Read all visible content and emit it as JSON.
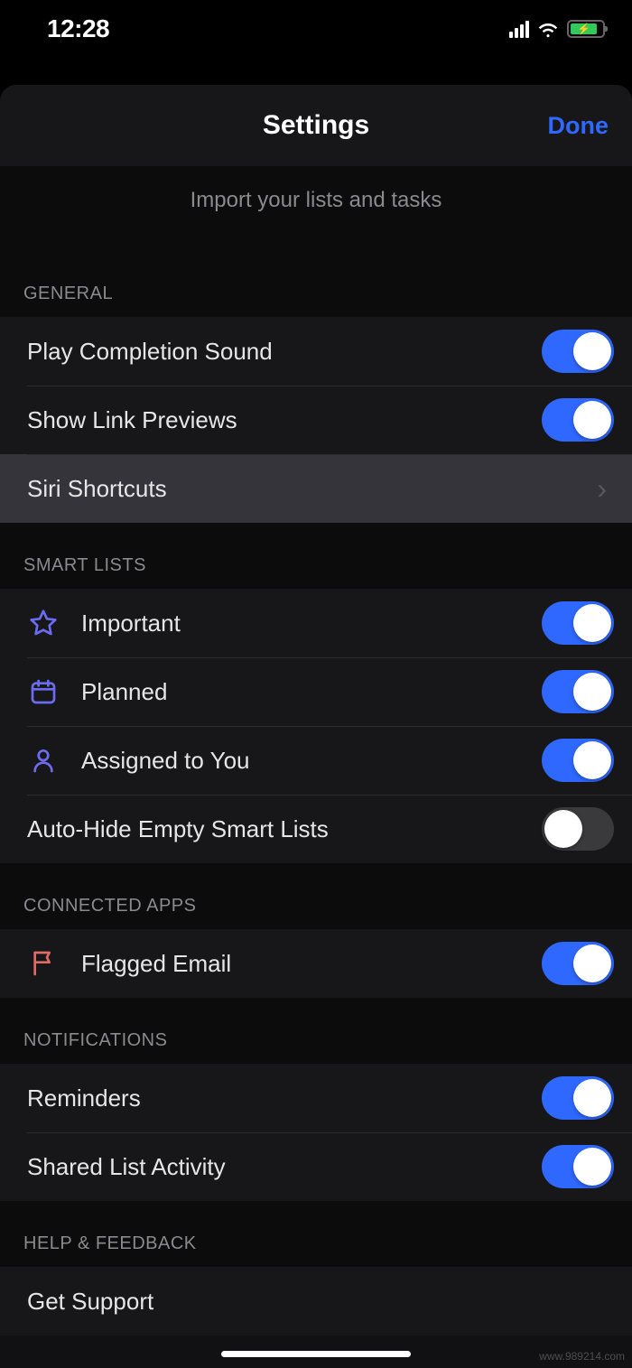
{
  "status": {
    "time": "12:28"
  },
  "header": {
    "title": "Settings",
    "done": "Done",
    "subtext": "Import your lists and tasks"
  },
  "sections": {
    "general": {
      "title": "GENERAL",
      "playCompletion": {
        "label": "Play Completion Sound",
        "on": true
      },
      "showLinkPreviews": {
        "label": "Show Link Previews",
        "on": true
      },
      "siriShortcuts": {
        "label": "Siri Shortcuts"
      }
    },
    "smartLists": {
      "title": "SMART LISTS",
      "important": {
        "label": "Important",
        "on": true
      },
      "planned": {
        "label": "Planned",
        "on": true
      },
      "assigned": {
        "label": "Assigned to You",
        "on": true
      },
      "autoHide": {
        "label": "Auto-Hide Empty Smart Lists",
        "on": false
      }
    },
    "connectedApps": {
      "title": "CONNECTED APPS",
      "flaggedEmail": {
        "label": "Flagged Email",
        "on": true
      }
    },
    "notifications": {
      "title": "NOTIFICATIONS",
      "reminders": {
        "label": "Reminders",
        "on": true
      },
      "sharedListActivity": {
        "label": "Shared List Activity",
        "on": true
      }
    },
    "helpFeedback": {
      "title": "HELP & FEEDBACK",
      "getSupport": {
        "label": "Get Support"
      }
    }
  },
  "watermark": "www.989214.com",
  "colors": {
    "accentBlue": "#2f68ff",
    "iconPurple": "#6c6cf2",
    "iconCoral": "#e06a64"
  }
}
